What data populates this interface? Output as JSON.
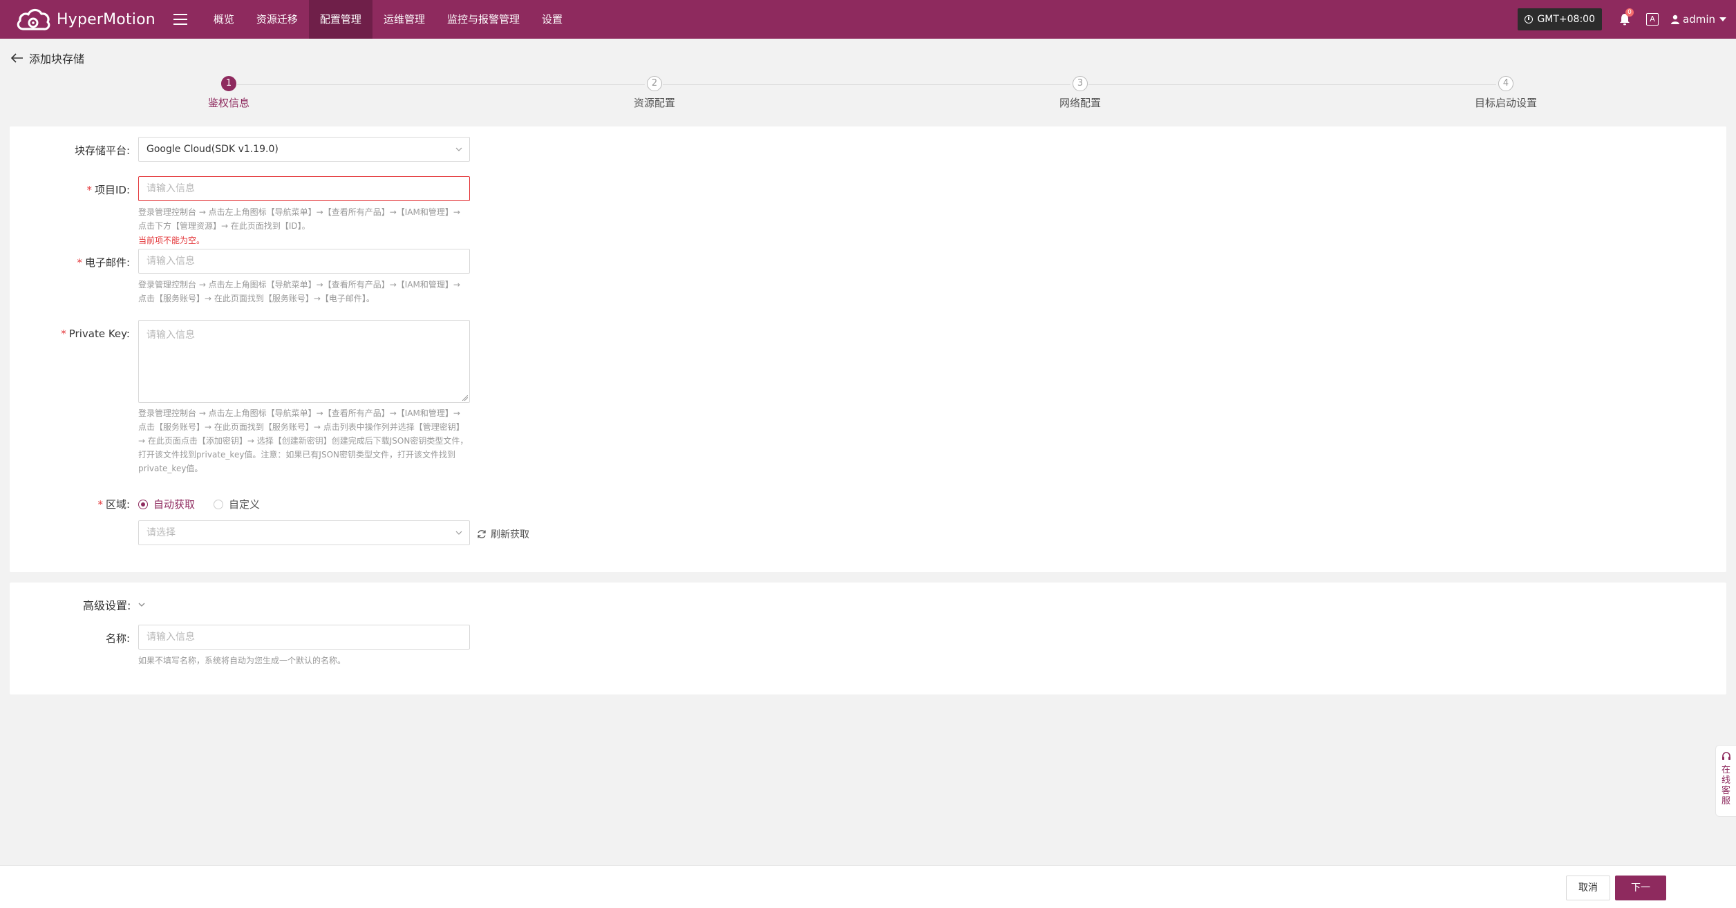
{
  "brand": {
    "name": "HyperMotion"
  },
  "nav": {
    "items": [
      {
        "label": "概览"
      },
      {
        "label": "资源迁移"
      },
      {
        "label": "配置管理",
        "active": true
      },
      {
        "label": "运维管理"
      },
      {
        "label": "监控与报警管理"
      },
      {
        "label": "设置"
      }
    ]
  },
  "header": {
    "timezone": "GMT+08:00",
    "notifications": "0",
    "lang": "A",
    "user": "admin"
  },
  "page": {
    "title": "添加块存储"
  },
  "steps": [
    {
      "num": "1",
      "label": "鉴权信息",
      "active": true
    },
    {
      "num": "2",
      "label": "资源配置"
    },
    {
      "num": "3",
      "label": "网络配置"
    },
    {
      "num": "4",
      "label": "目标启动设置"
    }
  ],
  "form": {
    "platform": {
      "label": "块存储平台:",
      "value": "Google Cloud(SDK v1.19.0)"
    },
    "project_id": {
      "label": "项目ID:",
      "placeholder": "请输入信息",
      "hint1": "登录管理控制台 → 点击左上角图标【导航菜单】→【查看所有产品】→【IAM和管理】→",
      "hint2": "点击下方【管理资源】→ 在此页面找到【ID】。",
      "error": "当前项不能为空。"
    },
    "email": {
      "label": "电子邮件:",
      "placeholder": "请输入信息",
      "hint1": "登录管理控制台 → 点击左上角图标【导航菜单】→【查看所有产品】→【IAM和管理】→",
      "hint2": "点击【服务账号】→ 在此页面找到【服务账号】→【电子邮件】。"
    },
    "private_key": {
      "label": "Private Key:",
      "placeholder": "请输入信息",
      "hint1": "登录管理控制台 → 点击左上角图标【导航菜单】→【查看所有产品】→【IAM和管理】→",
      "hint2": "点击【服务账号】→ 在此页面找到【服务账号】→ 点击列表中操作列并选择【管理密钥】",
      "hint3": "→ 在此页面点击【添加密钥】→ 选择【创建新密钥】创建完成后下载JSON密钥类型文件，",
      "hint4": "打开该文件找到private_key值。注意：如果已有JSON密钥类型文件，打开该文件找到",
      "hint5": "private_key值。"
    },
    "region": {
      "label": "区域:",
      "option_auto": "自动获取",
      "option_custom": "自定义",
      "select_placeholder": "请选择",
      "refresh": "刷新获取"
    }
  },
  "advanced": {
    "title": "高级设置:",
    "name_label": "名称:",
    "name_placeholder": "请输入信息",
    "name_hint": "如果不填写名称，系统将自动为您生成一个默认的名称。"
  },
  "footer": {
    "cancel": "取消",
    "next": "下一步"
  },
  "service": {
    "label": "在线客服"
  },
  "colors": {
    "brand": "#8e2a5e",
    "error": "#e4393c"
  }
}
